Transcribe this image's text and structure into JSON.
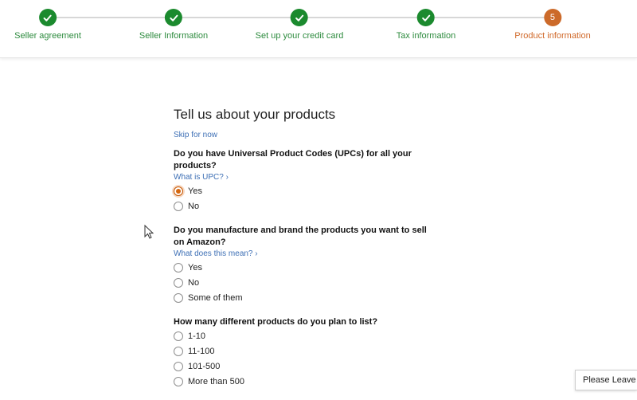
{
  "steps": [
    {
      "label": "Seller agreement",
      "status": "done"
    },
    {
      "label": "Seller Information",
      "status": "done"
    },
    {
      "label": "Set up your credit card",
      "status": "done"
    },
    {
      "label": "Tax information",
      "status": "done"
    },
    {
      "label": "Product information",
      "status": "active",
      "number": "5"
    }
  ],
  "colors": {
    "done": "#1b8a2e",
    "active": "#cc6a2a",
    "link": "#3d6fb5"
  },
  "page": {
    "title": "Tell us about your products",
    "skip_link": "Skip for now"
  },
  "questions": [
    {
      "text": "Do you have Universal Product Codes (UPCs) for all your products?",
      "help": "What is UPC? ›",
      "options": [
        "Yes",
        "No"
      ],
      "selected": "Yes"
    },
    {
      "text": "Do you manufacture and brand the products you want to sell on Amazon?",
      "help": "What does this mean? ›",
      "options": [
        "Yes",
        "No",
        "Some of them"
      ],
      "selected": null
    },
    {
      "text": "How many different products do you plan to list?",
      "options": [
        "1-10",
        "11-100",
        "101-500",
        "More than 500"
      ],
      "selected": null
    }
  ],
  "feedback_tab": "Please Leave"
}
